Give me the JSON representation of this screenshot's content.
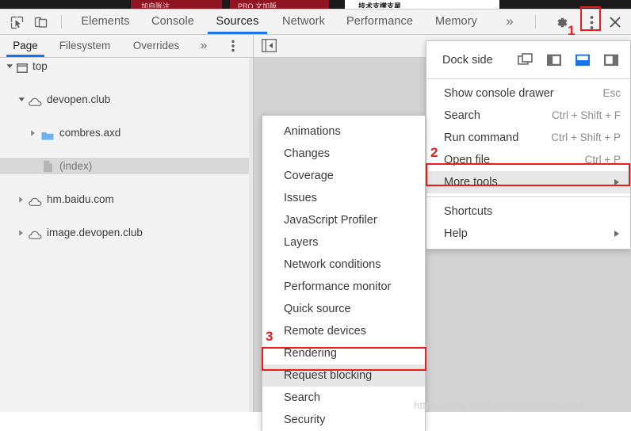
{
  "page_strip": {
    "description": "truncated web page above devtools",
    "segments": [
      {
        "text": "加自账注",
        "color": "#8e1521"
      },
      {
        "text": "PRO 文加版",
        "color": "#8e1521"
      },
      {
        "text": "技术支撑支星",
        "color": "#ffffff"
      }
    ]
  },
  "toolbar": {
    "inspect_icon": "inspect-cursor-icon",
    "device_icon": "device-toolbar-icon",
    "tabs": [
      {
        "label": "Elements",
        "selected": false
      },
      {
        "label": "Console",
        "selected": false
      },
      {
        "label": "Sources",
        "selected": true
      },
      {
        "label": "Network",
        "selected": false
      },
      {
        "label": "Performance",
        "selected": false
      },
      {
        "label": "Memory",
        "selected": false
      }
    ],
    "overflow_label": "»",
    "settings_icon": "gear-icon",
    "more_icon": "three-dot-vertical-icon",
    "close_icon": "close-icon"
  },
  "navigator": {
    "tabs": [
      {
        "label": "Page",
        "selected": true
      },
      {
        "label": "Filesystem",
        "selected": false
      },
      {
        "label": "Overrides",
        "selected": false
      }
    ],
    "overflow_label": "»",
    "more_icon": "three-dot-vertical-icon",
    "collapse_icon": "collapse-sidebar-icon",
    "tree": [
      {
        "label": "top",
        "icon": "frame-icon",
        "indent": 0,
        "expanded": true,
        "has_arrow": true,
        "selected": false
      },
      {
        "label": "devopen.club",
        "icon": "cloud-icon",
        "indent": 1,
        "expanded": true,
        "has_arrow": true,
        "selected": false
      },
      {
        "label": "combres.axd",
        "icon": "folder-icon",
        "indent": 2,
        "expanded": false,
        "has_arrow": true,
        "selected": false
      },
      {
        "label": "(index)",
        "icon": "document-icon",
        "indent": 2,
        "expanded": false,
        "has_arrow": false,
        "selected": true
      },
      {
        "label": "hm.baidu.com",
        "icon": "cloud-icon",
        "indent": 1,
        "expanded": false,
        "has_arrow": true,
        "selected": false
      },
      {
        "label": "image.devopen.club",
        "icon": "cloud-icon",
        "indent": 1,
        "expanded": false,
        "has_arrow": true,
        "selected": false
      }
    ]
  },
  "main_menu": {
    "dock_side": {
      "label": "Dock side",
      "options": [
        {
          "name": "undock-into-separate-window",
          "selected": false
        },
        {
          "name": "dock-to-left",
          "selected": false
        },
        {
          "name": "dock-to-bottom",
          "selected": true
        },
        {
          "name": "dock-to-right",
          "selected": false
        }
      ],
      "selected_color": "#1a73e8"
    },
    "items": [
      {
        "label": "Show console drawer",
        "shortcut": "Esc",
        "submenu": false,
        "highlight": false
      },
      {
        "label": "Search",
        "shortcut": "Ctrl + Shift + F",
        "submenu": false,
        "highlight": false
      },
      {
        "label": "Run command",
        "shortcut": "Ctrl + Shift + P",
        "submenu": false,
        "highlight": false
      },
      {
        "label": "Open file",
        "shortcut": "Ctrl + P",
        "submenu": false,
        "highlight": false
      },
      {
        "label": "More tools",
        "shortcut": "",
        "submenu": true,
        "highlight": true
      }
    ],
    "items_after_sep": [
      {
        "label": "Shortcuts",
        "shortcut": "",
        "submenu": false,
        "highlight": false
      },
      {
        "label": "Help",
        "shortcut": "",
        "submenu": true,
        "highlight": false
      }
    ]
  },
  "submenu": {
    "items": [
      {
        "label": "Animations",
        "highlight": false
      },
      {
        "label": "Changes",
        "highlight": false
      },
      {
        "label": "Coverage",
        "highlight": false
      },
      {
        "label": "Issues",
        "highlight": false
      },
      {
        "label": "JavaScript Profiler",
        "highlight": false
      },
      {
        "label": "Layers",
        "highlight": false
      },
      {
        "label": "Network conditions",
        "highlight": false
      },
      {
        "label": "Performance monitor",
        "highlight": false
      },
      {
        "label": "Quick source",
        "highlight": false
      },
      {
        "label": "Remote devices",
        "highlight": false
      },
      {
        "label": "Rendering",
        "highlight": false
      },
      {
        "label": "Request blocking",
        "highlight": true
      },
      {
        "label": "Search",
        "highlight": false
      },
      {
        "label": "Security",
        "highlight": false
      }
    ]
  },
  "annotations": {
    "color": "#ee1b1b",
    "markers": [
      {
        "number": "1",
        "target": "three-dot-vertical-icon"
      },
      {
        "number": "2",
        "target": "more-tools-menu-item"
      },
      {
        "number": "3",
        "target": "request-blocking-menu-item"
      }
    ]
  },
  "watermark": {
    "text": "https://blog.csdn.net/kouzuhuai2956"
  }
}
